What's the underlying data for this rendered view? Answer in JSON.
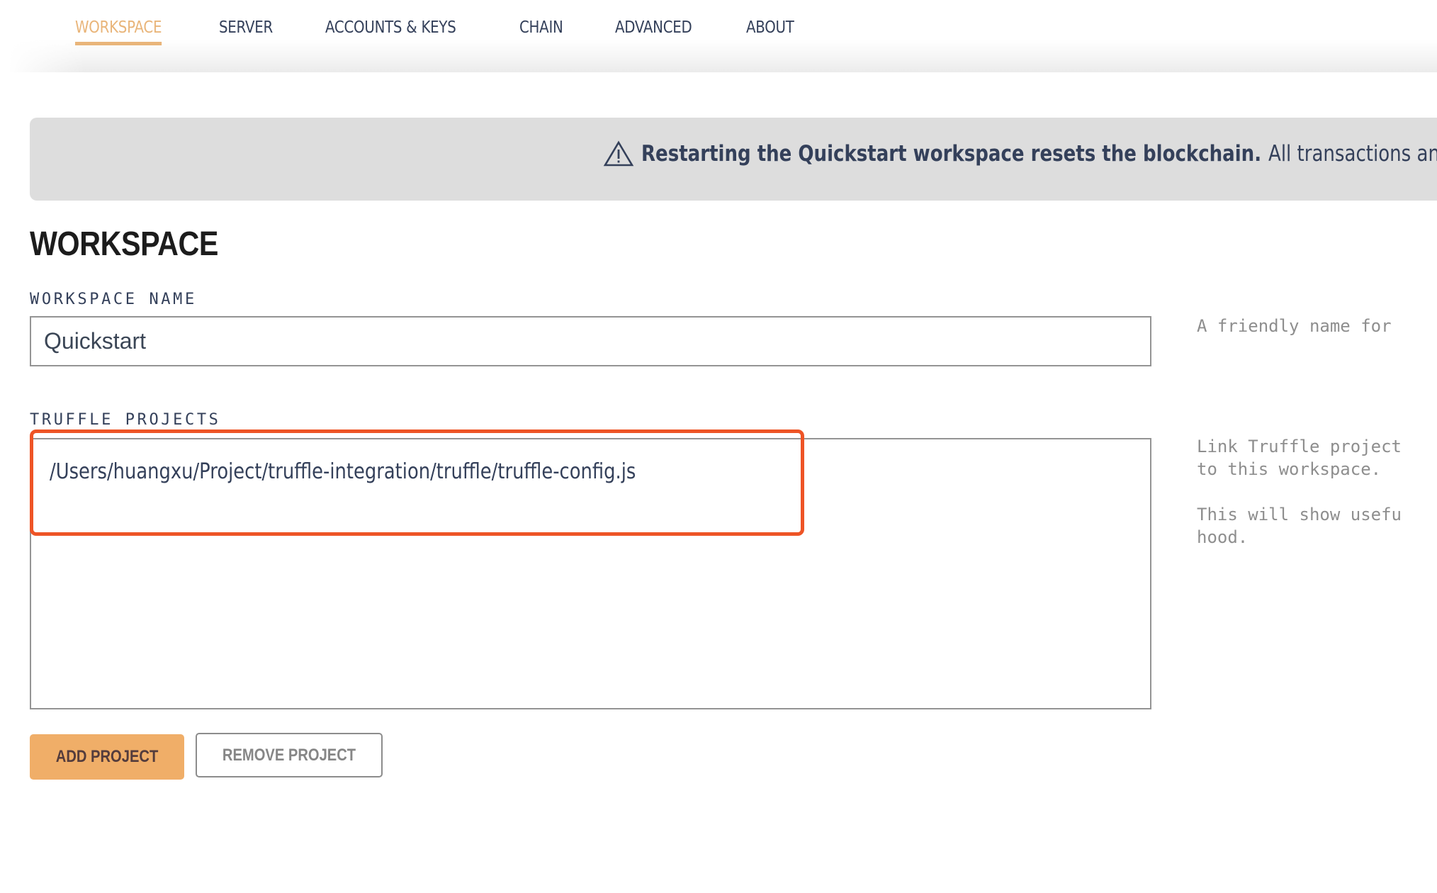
{
  "nav": {
    "tabs": [
      {
        "label": "WORKSPACE",
        "active": true
      },
      {
        "label": "SERVER",
        "active": false
      },
      {
        "label": "ACCOUNTS & KEYS",
        "active": false
      },
      {
        "label": "CHAIN",
        "active": false
      },
      {
        "label": "ADVANCED",
        "active": false
      },
      {
        "label": "ABOUT",
        "active": false
      }
    ]
  },
  "banner": {
    "icon": "warning-icon",
    "bold_text": "Restarting the Quickstart workspace resets the blockchain.",
    "text": "All transactions an"
  },
  "section": {
    "title": "WORKSPACE"
  },
  "workspace_name": {
    "label": "WORKSPACE NAME",
    "value": "Quickstart",
    "help": "A friendly name for"
  },
  "truffle_projects": {
    "label": "TRUFFLE PROJECTS",
    "items": [
      "/Users/huangxu/Project/truffle-integration/truffle/truffle-config.js"
    ],
    "help_lines": [
      "Link Truffle project",
      "to this workspace.",
      "",
      "This will show usefu",
      "hood."
    ]
  },
  "buttons": {
    "add_project": "ADD PROJECT",
    "remove_project": "REMOVE PROJECT"
  },
  "colors": {
    "accent": "#e9b57a",
    "button_primary": "#f0ae68",
    "highlight": "#ee5426",
    "banner_bg": "#dddddd",
    "text": "#34405a"
  }
}
